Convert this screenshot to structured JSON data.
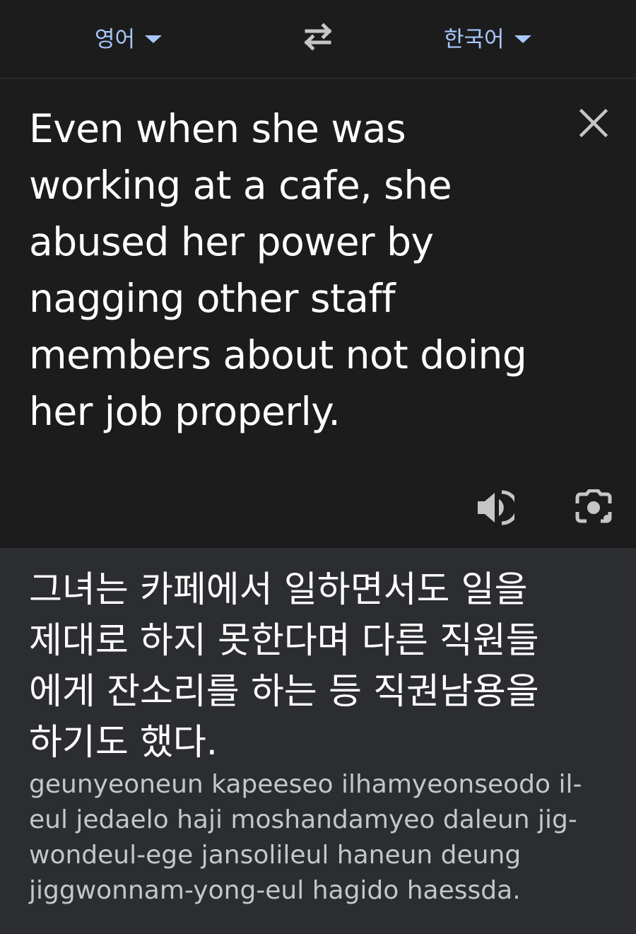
{
  "header": {
    "source_language": "영어",
    "target_language": "한국어"
  },
  "icons": {
    "language_dropdown": "caret-down-icon",
    "swap": "swap-arrows-icon",
    "clear": "close-icon",
    "speaker": "speaker-icon",
    "camera": "camera-lens-icon"
  },
  "source": {
    "lines": [
      "Even when she was",
      "working at a cafe, she",
      "abused her power by",
      "nagging other staff",
      "members about not doing",
      "her job properly."
    ]
  },
  "result": {
    "lines": [
      "그녀는 카페에서 일하면서도 일을",
      "제대로 하지 못한다며 다른 직원들",
      "에게 잔소리를 하는 등 직권남용을",
      "하기도 했다."
    ],
    "romanization_lines": [
      "geunyeoneun kapeeseo ilhamyeonseodo il-",
      "eul jedaelo haji moshandamyeo daleun jig-",
      "wondeul-ege jansolileul haneun deung",
      "jiggwonnam-yong-eul hagido haessda."
    ]
  },
  "colors": {
    "background": "#1c1c1d",
    "result_background": "#2b2d31",
    "accent": "#a8c7fa",
    "icon": "#c4c7c5",
    "romanization": "#c4c7c5"
  }
}
